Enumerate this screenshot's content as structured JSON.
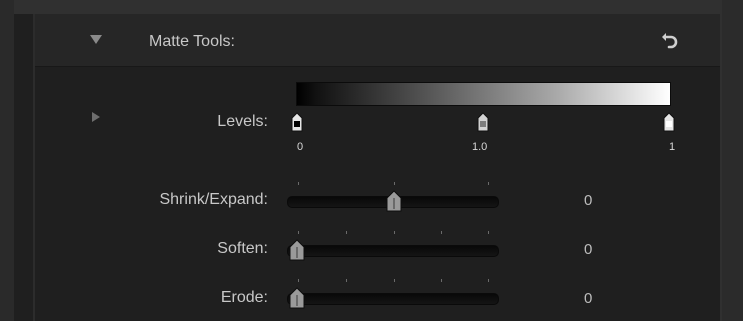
{
  "panel": {
    "title": "Matte Tools:",
    "reset_icon": "reset-arrow-icon"
  },
  "levels": {
    "label": "Levels:",
    "gradient": {
      "from": "#000000",
      "to": "#ffffff"
    },
    "handles": [
      {
        "name": "black-point",
        "value_label": "0"
      },
      {
        "name": "gamma",
        "value_label": "1.0"
      },
      {
        "name": "white-point",
        "value_label": "1"
      }
    ]
  },
  "sliders": [
    {
      "id": "shrink-expand",
      "label": "Shrink/Expand:",
      "value": "0",
      "position_fraction": 0.5
    },
    {
      "id": "soften",
      "label": "Soften:",
      "value": "0",
      "position_fraction": 0.0
    },
    {
      "id": "erode",
      "label": "Erode:",
      "value": "0",
      "position_fraction": 0.0
    }
  ]
}
